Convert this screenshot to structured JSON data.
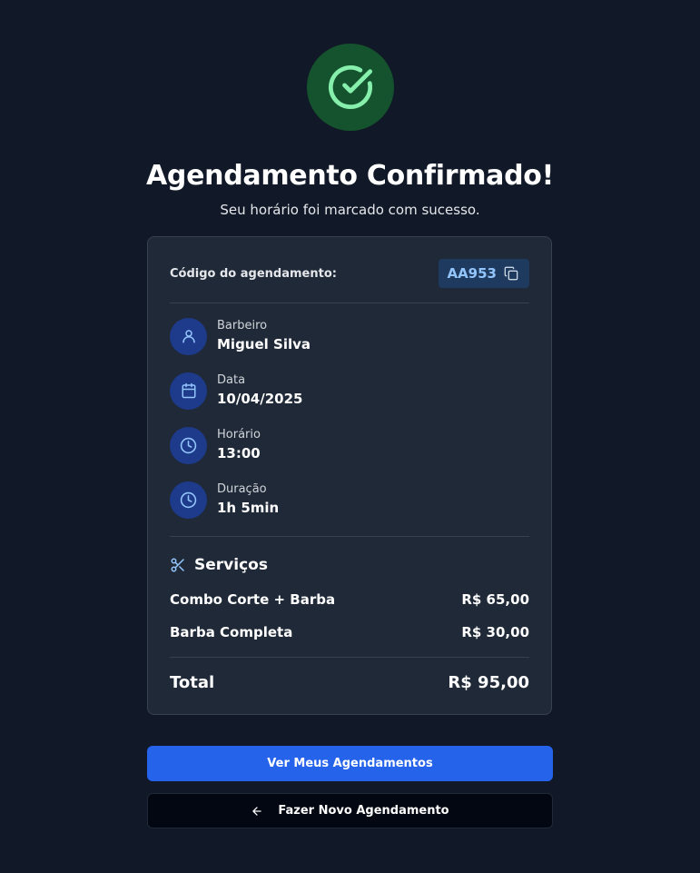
{
  "header": {
    "title": "Agendamento Confirmado!",
    "subtitle": "Seu horário foi marcado com sucesso."
  },
  "booking": {
    "code_label": "Código do agendamento:",
    "code": "AA953",
    "details": [
      {
        "label": "Barbeiro",
        "value": "Miguel Silva",
        "icon": "user-icon"
      },
      {
        "label": "Data",
        "value": "10/04/2025",
        "icon": "calendar-icon"
      },
      {
        "label": "Horário",
        "value": "13:00",
        "icon": "clock-icon"
      },
      {
        "label": "Duração",
        "value": "1h 5min",
        "icon": "clock-icon"
      }
    ],
    "services_title": "Serviços",
    "services": [
      {
        "name": "Combo Corte + Barba",
        "price": "R$ 65,00"
      },
      {
        "name": "Barba Completa",
        "price": "R$ 30,00"
      }
    ],
    "total_label": "Total",
    "total_value": "R$ 95,00"
  },
  "actions": {
    "primary_label": "Ver Meus Agendamentos",
    "secondary_label": "Fazer Novo Agendamento"
  },
  "colors": {
    "background": "#111827",
    "card": "#1f2937",
    "accent": "#2563eb",
    "success_circle": "#14532d",
    "success_check": "#86efac",
    "code_text": "#93c5fd"
  }
}
